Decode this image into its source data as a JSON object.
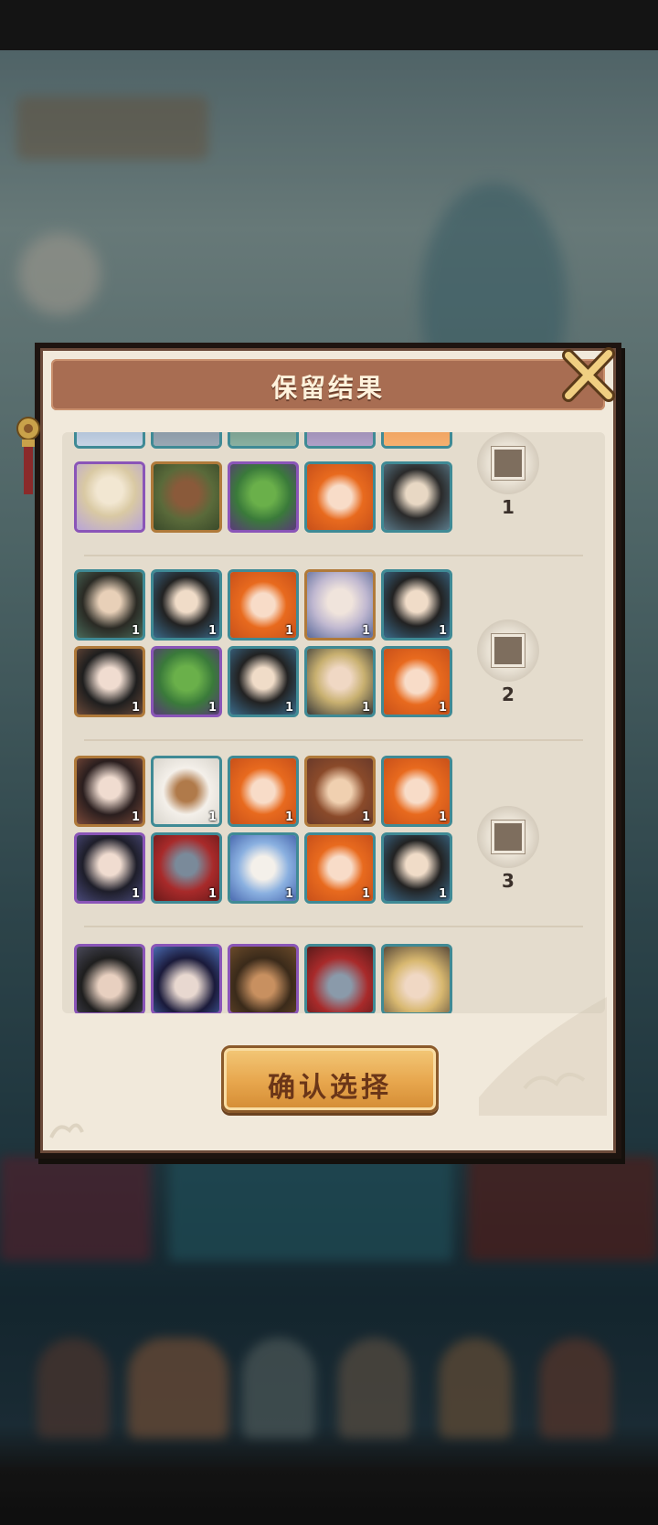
{
  "dialog": {
    "title": "保留结果",
    "confirm_label": "确认选择"
  },
  "groups": [
    {
      "option_label": "1",
      "rows": [
        [
          "purple",
          "gold",
          "purple",
          "teal",
          "teal"
        ]
      ],
      "levels": [
        [
          null,
          null,
          null,
          null,
          null
        ]
      ]
    },
    {
      "option_label": "2",
      "rows": [
        [
          "teal",
          "teal",
          "teal",
          "gold",
          "teal"
        ],
        [
          "gold",
          "purple",
          "teal",
          "teal",
          "teal"
        ]
      ],
      "levels": [
        [
          "1",
          "1",
          "1",
          "1",
          "1"
        ],
        [
          "1",
          "1",
          "1",
          "1",
          "1"
        ]
      ]
    },
    {
      "option_label": "3",
      "rows": [
        [
          "gold",
          "teal",
          "teal",
          "gold",
          "teal"
        ],
        [
          "purple",
          "teal",
          "teal",
          "teal",
          "teal"
        ]
      ],
      "levels": [
        [
          "1",
          "1",
          "1",
          "1",
          "1"
        ],
        [
          "1",
          "1",
          "1",
          "1",
          "1"
        ]
      ]
    }
  ],
  "colors": {
    "header": "#a86d52",
    "panel": "#f1e9db",
    "button": "#e7a64d",
    "frame_teal": "#3f8a95",
    "frame_gold": "#b07a3a",
    "frame_purple": "#8a55b8"
  }
}
